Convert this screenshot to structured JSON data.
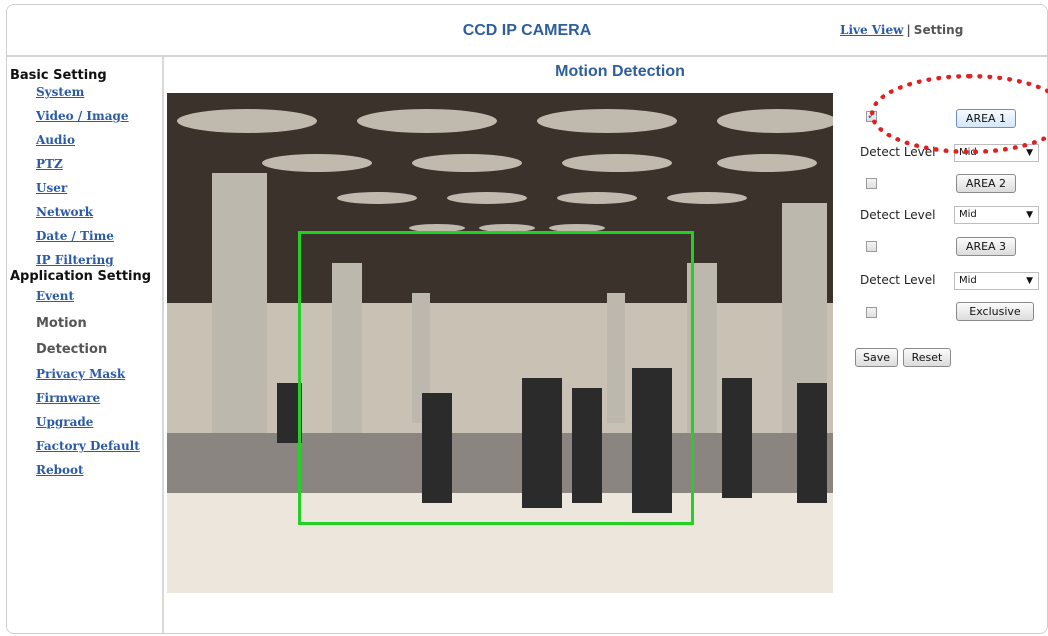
{
  "app": {
    "title": "CCD IP CAMERA"
  },
  "topnav": {
    "live_view": "Live View",
    "separator": "|",
    "setting": "Setting"
  },
  "sidebar": {
    "basic_heading": "Basic Setting",
    "basic_items": [
      {
        "label": "System"
      },
      {
        "label": "Video / Image"
      },
      {
        "label": "Audio"
      },
      {
        "label": "PTZ"
      },
      {
        "label": "User"
      },
      {
        "label": "Network"
      },
      {
        "label": "Date / Time"
      },
      {
        "label": "IP Filtering"
      }
    ],
    "app_heading": "Application Setting",
    "app_items": [
      {
        "label": "Event"
      },
      {
        "label": "Motion"
      },
      {
        "label": "Detection"
      },
      {
        "label": "Privacy Mask"
      },
      {
        "label": "Firmware"
      },
      {
        "label": "Upgrade"
      },
      {
        "label": "Factory Default"
      },
      {
        "label": "Reboot"
      }
    ]
  },
  "main": {
    "page_title": "Motion Detection",
    "areas": [
      {
        "button": "AREA 1",
        "checked": true,
        "detect_label": "Detect Level",
        "level": "Mid"
      },
      {
        "button": "AREA 2",
        "checked": false,
        "detect_label": "Detect Level",
        "level": "Mid"
      },
      {
        "button": "AREA 3",
        "checked": false,
        "detect_label": "Detect Level",
        "level": "Mid"
      }
    ],
    "exclusive": {
      "button": "Exclusive",
      "checked": false
    },
    "save_label": "Save",
    "reset_label": "Reset"
  },
  "colors": {
    "accent": "#2f5f9a",
    "link": "#2a5aa8",
    "motion_box": "#24d024",
    "annotation": "#e02020"
  }
}
